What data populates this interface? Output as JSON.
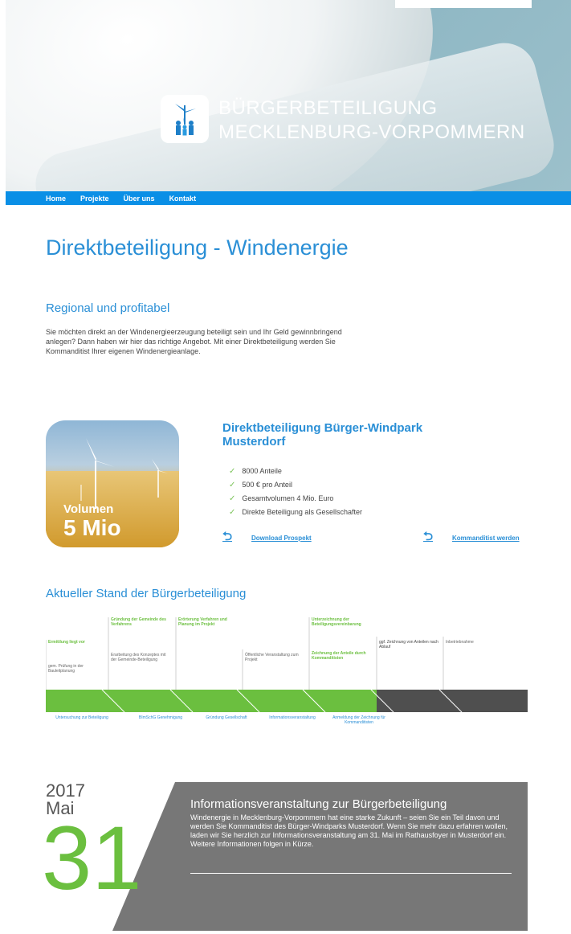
{
  "header": {
    "brand_line1": "BÜRGERBETEILIGUNG",
    "brand_line2": "MECKLENBURG-VORPOMMERN"
  },
  "nav": {
    "items": [
      "Home",
      "Projekte",
      "Über uns",
      "Kontakt"
    ]
  },
  "page": {
    "title": "Direktbeteiligung - Windenergie",
    "section_title": "Regional und profitabel",
    "intro": "Sie möchten direkt an der Windenergieerzeugung beteiligt sein und Ihr Geld gewinnbringend anlegen? Dann haben wir hier das richtige Angebot. Mit einer Direktbeteiligung werden Sie Kommanditist Ihrer eigenen Windenergieanlage."
  },
  "offer": {
    "image_label": "Volumen",
    "image_value": "5 Mio",
    "title": "Direktbeteiligung Bürger-Windpark Musterdorf",
    "features": [
      "8000 Anteile",
      "500 € pro Anteil",
      "Gesamtvolumen 4 Mio. Euro",
      "Direkte Beteiligung als Gesellschafter"
    ],
    "download_label": "Download Prospekt",
    "join_label": "Kommanditist werden"
  },
  "timeline": {
    "title": "Aktueller Stand der Bürgerbeteiligung",
    "top_notes": [
      "Ermittlung liegt vor",
      "gem. Prüfung in der Bauleitplanung",
      "Gründung der Gemeinde des Verfahrens",
      "Erarbeitung des Konzeptes mit der Gemeinde-Beteiligung",
      "Erörterung Verfahren und Planung im Projekt",
      "Öffentliche Veranstaltung zum Projekt",
      "Unterzeichnung der Beteiligungsvereinbarung",
      "Zeichnung der Anteile durch Kommanditisten",
      "ggf. Zeichnung von Anteilen nach Ablauf",
      "Inbetriebnahme"
    ],
    "bottom_labels": [
      "Untersuchung zur Beteiligung",
      "BImSchG Genehmigung",
      "Gründung Gesellschaft",
      "Informationsveranstaltung",
      "Anmeldung der Zeichnung für Kommanditisten"
    ]
  },
  "event": {
    "year": "2017",
    "month": "Mai",
    "day": "31",
    "title": "Informationsveranstaltung zur Bürgerbeteiligung",
    "text": "Windenergie in Mecklenburg-Vorpommern hat eine starke Zukunft – seien Sie ein Teil davon und werden Sie Kommanditist des Bürger-Windparks Musterdorf. Wenn Sie mehr dazu erfahren wollen, laden wir Sie herzlich zur Informationsveranstaltung am 31. Mai im Rathausfoyer in Musterdorf ein. Weitere Informationen folgen in Kürze."
  },
  "colors": {
    "accent_blue": "#0a8fe6",
    "heading_blue": "#2a8fd6",
    "green": "#6bbf3f",
    "dark_gray": "#4f4f4f",
    "event_gray": "#777777"
  }
}
